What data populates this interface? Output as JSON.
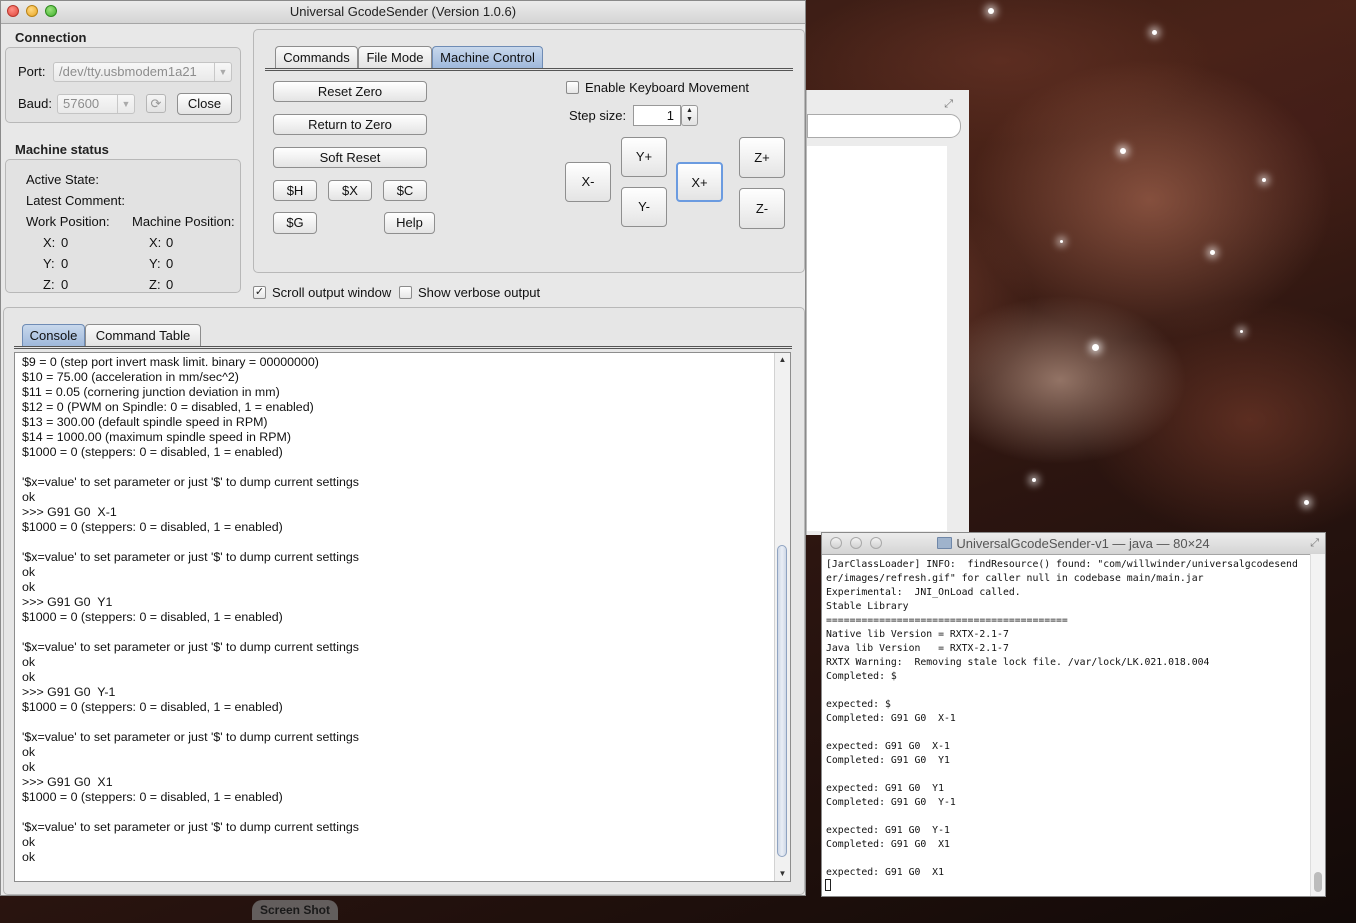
{
  "main_window": {
    "title": "Universal GcodeSender (Version 1.0.6)",
    "connection": {
      "title": "Connection",
      "port_label": "Port:",
      "port_value": "/dev/tty.usbmodem1a21",
      "baud_label": "Baud:",
      "baud_value": "57600",
      "close_label": "Close"
    },
    "machine_status": {
      "title": "Machine status",
      "active_state_label": "Active State:",
      "latest_comment_label": "Latest Comment:",
      "work_position_label": "Work Position:",
      "machine_position_label": "Machine Position:",
      "work": {
        "x_label": "X:",
        "x": "0",
        "y_label": "Y:",
        "y": "0",
        "z_label": "Z:",
        "z": "0"
      },
      "machine": {
        "x_label": "X:",
        "x": "0",
        "y_label": "Y:",
        "y": "0",
        "z_label": "Z:",
        "z": "0"
      }
    },
    "tabs": [
      {
        "label": "Commands"
      },
      {
        "label": "File Mode"
      },
      {
        "label": "Machine Control",
        "active": true
      }
    ],
    "machine_control": {
      "reset_zero": "Reset Zero",
      "return_to_zero": "Return to Zero",
      "soft_reset": "Soft Reset",
      "home_cmd": "$H",
      "kill_alarm_cmd": "$X",
      "check_mode_cmd": "$C",
      "parser_state_cmd": "$G",
      "help": "Help",
      "enable_keyboard_label": "Enable Keyboard Movement",
      "enable_keyboard_checked": false,
      "step_size_label": "Step size:",
      "step_size_value": "1",
      "x_minus": "X-",
      "x_plus": "X+",
      "y_plus": "Y+",
      "y_minus": "Y-",
      "z_plus": "Z+",
      "z_minus": "Z-"
    },
    "scroll_output_label": "Scroll output window",
    "scroll_output_checked": true,
    "verbose_output_label": "Show verbose output",
    "verbose_output_checked": false,
    "bottom_tabs": [
      {
        "label": "Console",
        "active": true
      },
      {
        "label": "Command Table"
      }
    ],
    "console_lines": [
      "$9 = 0 (step port invert mask limit. binary = 00000000)",
      "$10 = 75.00 (acceleration in mm/sec^2)",
      "$11 = 0.05 (cornering junction deviation in mm)",
      "$12 = 0 (PWM on Spindle: 0 = disabled, 1 = enabled)",
      "$13 = 300.00 (default spindle speed in RPM)",
      "$14 = 1000.00 (maximum spindle speed in RPM)",
      "$1000 = 0 (steppers: 0 = disabled, 1 = enabled)",
      "",
      "'$x=value' to set parameter or just '$' to dump current settings",
      "ok",
      ">>> G91 G0  X-1",
      "$1000 = 0 (steppers: 0 = disabled, 1 = enabled)",
      "",
      "'$x=value' to set parameter or just '$' to dump current settings",
      "ok",
      "ok",
      ">>> G91 G0  Y1",
      "$1000 = 0 (steppers: 0 = disabled, 1 = enabled)",
      "",
      "'$x=value' to set parameter or just '$' to dump current settings",
      "ok",
      "ok",
      ">>> G91 G0  Y-1",
      "$1000 = 0 (steppers: 0 = disabled, 1 = enabled)",
      "",
      "'$x=value' to set parameter or just '$' to dump current settings",
      "ok",
      "ok",
      ">>> G91 G0  X1",
      "$1000 = 0 (steppers: 0 = disabled, 1 = enabled)",
      "",
      "'$x=value' to set parameter or just '$' to dump current settings",
      "ok",
      "ok"
    ]
  },
  "terminal": {
    "title": "UniversalGcodeSender-v1 — java — 80×24",
    "lines": [
      "[JarClassLoader] INFO:  findResource() found: \"com/willwinder/universalgcodesend",
      "er/images/refresh.gif\" for caller null in codebase main/main.jar",
      "Experimental:  JNI_OnLoad called.",
      "Stable Library",
      "=========================================",
      "Native lib Version = RXTX-2.1-7",
      "Java lib Version   = RXTX-2.1-7",
      "RXTX Warning:  Removing stale lock file. /var/lock/LK.021.018.004",
      "Completed: $",
      "",
      "expected: $",
      "Completed: G91 G0  X-1",
      "",
      "expected: G91 G0  X-1",
      "Completed: G91 G0  Y1",
      "",
      "expected: G91 G0  Y1",
      "Completed: G91 G0  Y-1",
      "",
      "expected: G91 G0  Y-1",
      "Completed: G91 G0  X1",
      "",
      "expected: G91 G0  X1"
    ]
  },
  "dock": {
    "screen_shot_label": "Screen Shot"
  },
  "icons": {
    "refresh": "refresh-icon",
    "folder": "folder-icon",
    "dropdown": "chevron-down-icon",
    "resize": "resize-icon"
  }
}
